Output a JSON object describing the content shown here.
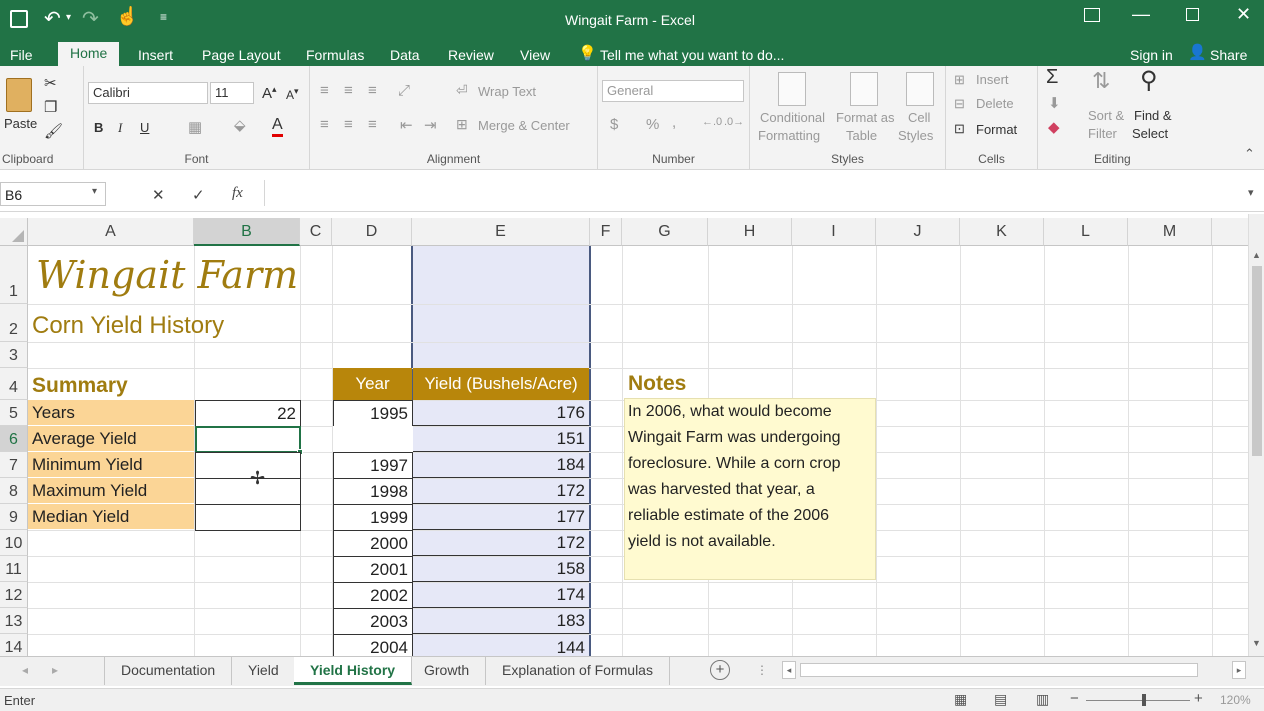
{
  "window": {
    "title": "Wingait Farm - Excel",
    "sign_in": "Sign in",
    "share": "Share"
  },
  "ribbon_tabs": [
    "File",
    "Home",
    "Insert",
    "Page Layout",
    "Formulas",
    "Data",
    "Review",
    "View"
  ],
  "tell_me": "Tell me what you want to do...",
  "clipboard": {
    "paste": "Paste",
    "label": "Clipboard"
  },
  "font": {
    "name": "Calibri",
    "size": "11",
    "label": "Font",
    "bold": "B",
    "italic": "I",
    "underline": "U"
  },
  "alignment": {
    "wrap_text": "Wrap Text",
    "merge_center": "Merge & Center",
    "label": "Alignment"
  },
  "number": {
    "format": "General",
    "label": "Number",
    "dollar": "$",
    "percent": "%",
    "comma": ","
  },
  "styles": {
    "conditional_1": "Conditional",
    "conditional_2": "Formatting",
    "format_as_1": "Format as",
    "format_as_2": "Table",
    "cell_styles_1": "Cell",
    "cell_styles_2": "Styles",
    "label": "Styles"
  },
  "cells": {
    "insert": "Insert",
    "delete": "Delete",
    "format": "Format",
    "label": "Cells"
  },
  "editing": {
    "sort_1": "Sort &",
    "sort_2": "Filter",
    "find_1": "Find &",
    "find_2": "Select",
    "label": "Editing"
  },
  "formula_bar": {
    "name_box": "B6",
    "fx": "fx",
    "cancel": "✕",
    "enter": "✓",
    "value": ""
  },
  "columns": [
    "A",
    "B",
    "C",
    "D",
    "E",
    "F",
    "G",
    "H",
    "I",
    "J",
    "K",
    "L",
    "M"
  ],
  "rows": [
    "1",
    "2",
    "3",
    "4",
    "5",
    "6",
    "7",
    "8",
    "9",
    "10",
    "11",
    "12",
    "13",
    "14"
  ],
  "sheet": {
    "title": "Wingait Farm",
    "subtitle": "Corn Yield History",
    "summary_label": "Summary",
    "summary": [
      {
        "label": "Years",
        "value": "22"
      },
      {
        "label": "Average Yield",
        "value": ""
      },
      {
        "label": "Minimum Yield",
        "value": ""
      },
      {
        "label": "Maximum Yield",
        "value": ""
      },
      {
        "label": "Median Yield",
        "value": ""
      }
    ],
    "table_headers": {
      "year": "Year",
      "yield": "Yield (Bushels/Acre)"
    },
    "table": [
      {
        "year": "1995",
        "yield": "176"
      },
      {
        "year": "",
        "yield": "151"
      },
      {
        "year": "1997",
        "yield": "184"
      },
      {
        "year": "1998",
        "yield": "172"
      },
      {
        "year": "1999",
        "yield": "177"
      },
      {
        "year": "2000",
        "yield": "172"
      },
      {
        "year": "2001",
        "yield": "158"
      },
      {
        "year": "2002",
        "yield": "174"
      },
      {
        "year": "2003",
        "yield": "183"
      },
      {
        "year": "2004",
        "yield": "144"
      }
    ],
    "notes_label": "Notes",
    "notes_lines": [
      "In 2006, what would become",
      "Wingait Farm was undergoing",
      "foreclosure. While a corn crop",
      "was harvested that year, a",
      "reliable estimate of the 2006",
      "yield is not available."
    ]
  },
  "sheet_tabs": [
    "Documentation",
    "Yield",
    "Yield History",
    "Growth",
    "Explanation of Formulas"
  ],
  "active_sheet": "Yield History",
  "status": {
    "mode": "Enter",
    "zoom": "120%"
  },
  "colors": {
    "excel_green": "#217346",
    "header_gold": "#b8860b",
    "label_fill": "#fbd596",
    "title_text": "#a07c10",
    "notes_fill": "#fffad0",
    "column_e_fill": "#e6e8f7"
  }
}
